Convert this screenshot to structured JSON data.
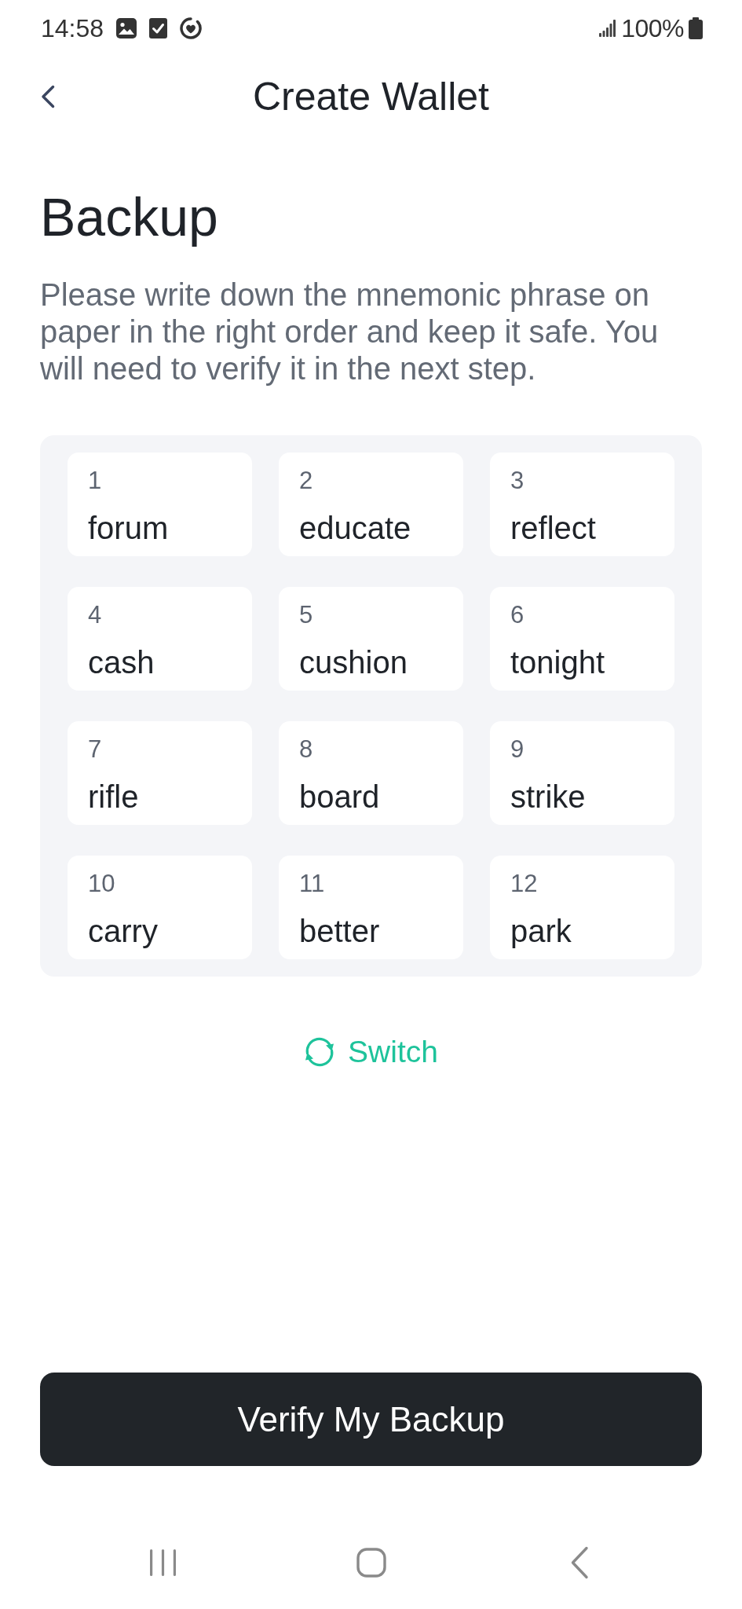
{
  "status_bar": {
    "time": "14:58",
    "battery": "100%"
  },
  "header": {
    "title": "Create Wallet"
  },
  "heading": "Backup",
  "description": "Please write down the mnemonic phrase on paper in the right order and keep it safe. You will need to verify it in the next step.",
  "mnemonic": [
    {
      "number": "1",
      "word": "forum"
    },
    {
      "number": "2",
      "word": "educate"
    },
    {
      "number": "3",
      "word": "reflect"
    },
    {
      "number": "4",
      "word": "cash"
    },
    {
      "number": "5",
      "word": "cushion"
    },
    {
      "number": "6",
      "word": "tonight"
    },
    {
      "number": "7",
      "word": "rifle"
    },
    {
      "number": "8",
      "word": "board"
    },
    {
      "number": "9",
      "word": "strike"
    },
    {
      "number": "10",
      "word": "carry"
    },
    {
      "number": "11",
      "word": "better"
    },
    {
      "number": "12",
      "word": "park"
    }
  ],
  "switch_link": {
    "label": "Switch"
  },
  "primary_button": {
    "label": "Verify My Backup"
  }
}
